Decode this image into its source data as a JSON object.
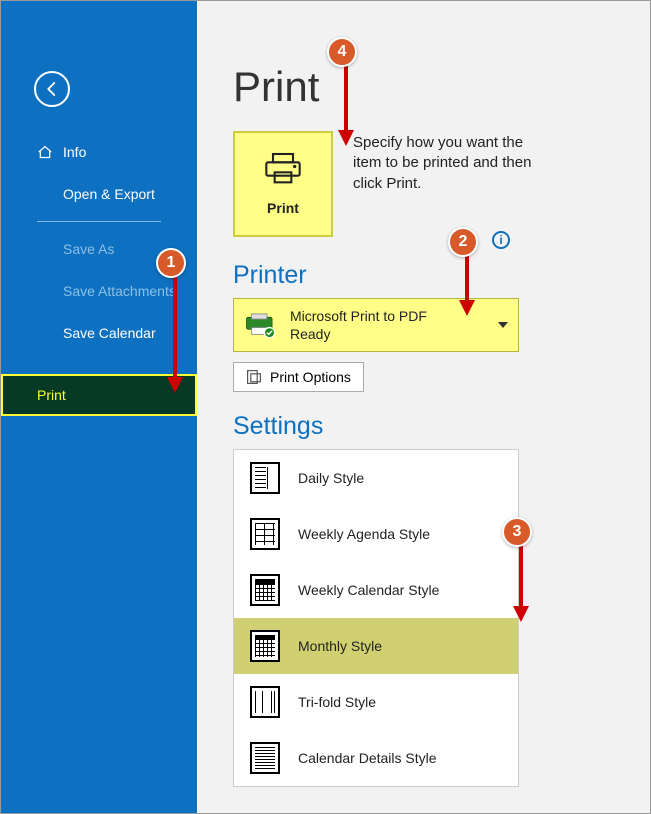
{
  "sidebar": {
    "items": {
      "info": "Info",
      "open_export": "Open & Export",
      "save_as": "Save As",
      "save_attachments": "Save Attachments",
      "save_calendar": "Save Calendar",
      "print": "Print"
    }
  },
  "page": {
    "title": "Print",
    "print_tile_label": "Print",
    "description": "Specify how you want the item to be printed and then click Print."
  },
  "printer": {
    "section_title": "Printer",
    "name": "Microsoft Print to PDF",
    "status": "Ready",
    "options_label": "Print Options",
    "info_glyph": "i"
  },
  "settings": {
    "section_title": "Settings",
    "styles": [
      {
        "label": "Daily Style"
      },
      {
        "label": "Weekly Agenda Style"
      },
      {
        "label": "Weekly Calendar Style"
      },
      {
        "label": "Monthly Style"
      },
      {
        "label": "Tri-fold Style"
      },
      {
        "label": "Calendar Details Style"
      }
    ],
    "selected_index": 3
  },
  "callouts": {
    "1": "1",
    "2": "2",
    "3": "3",
    "4": "4"
  },
  "colors": {
    "accent": "#0e70c0",
    "highlight": "#ffff88",
    "callout": "#d85a2a"
  }
}
